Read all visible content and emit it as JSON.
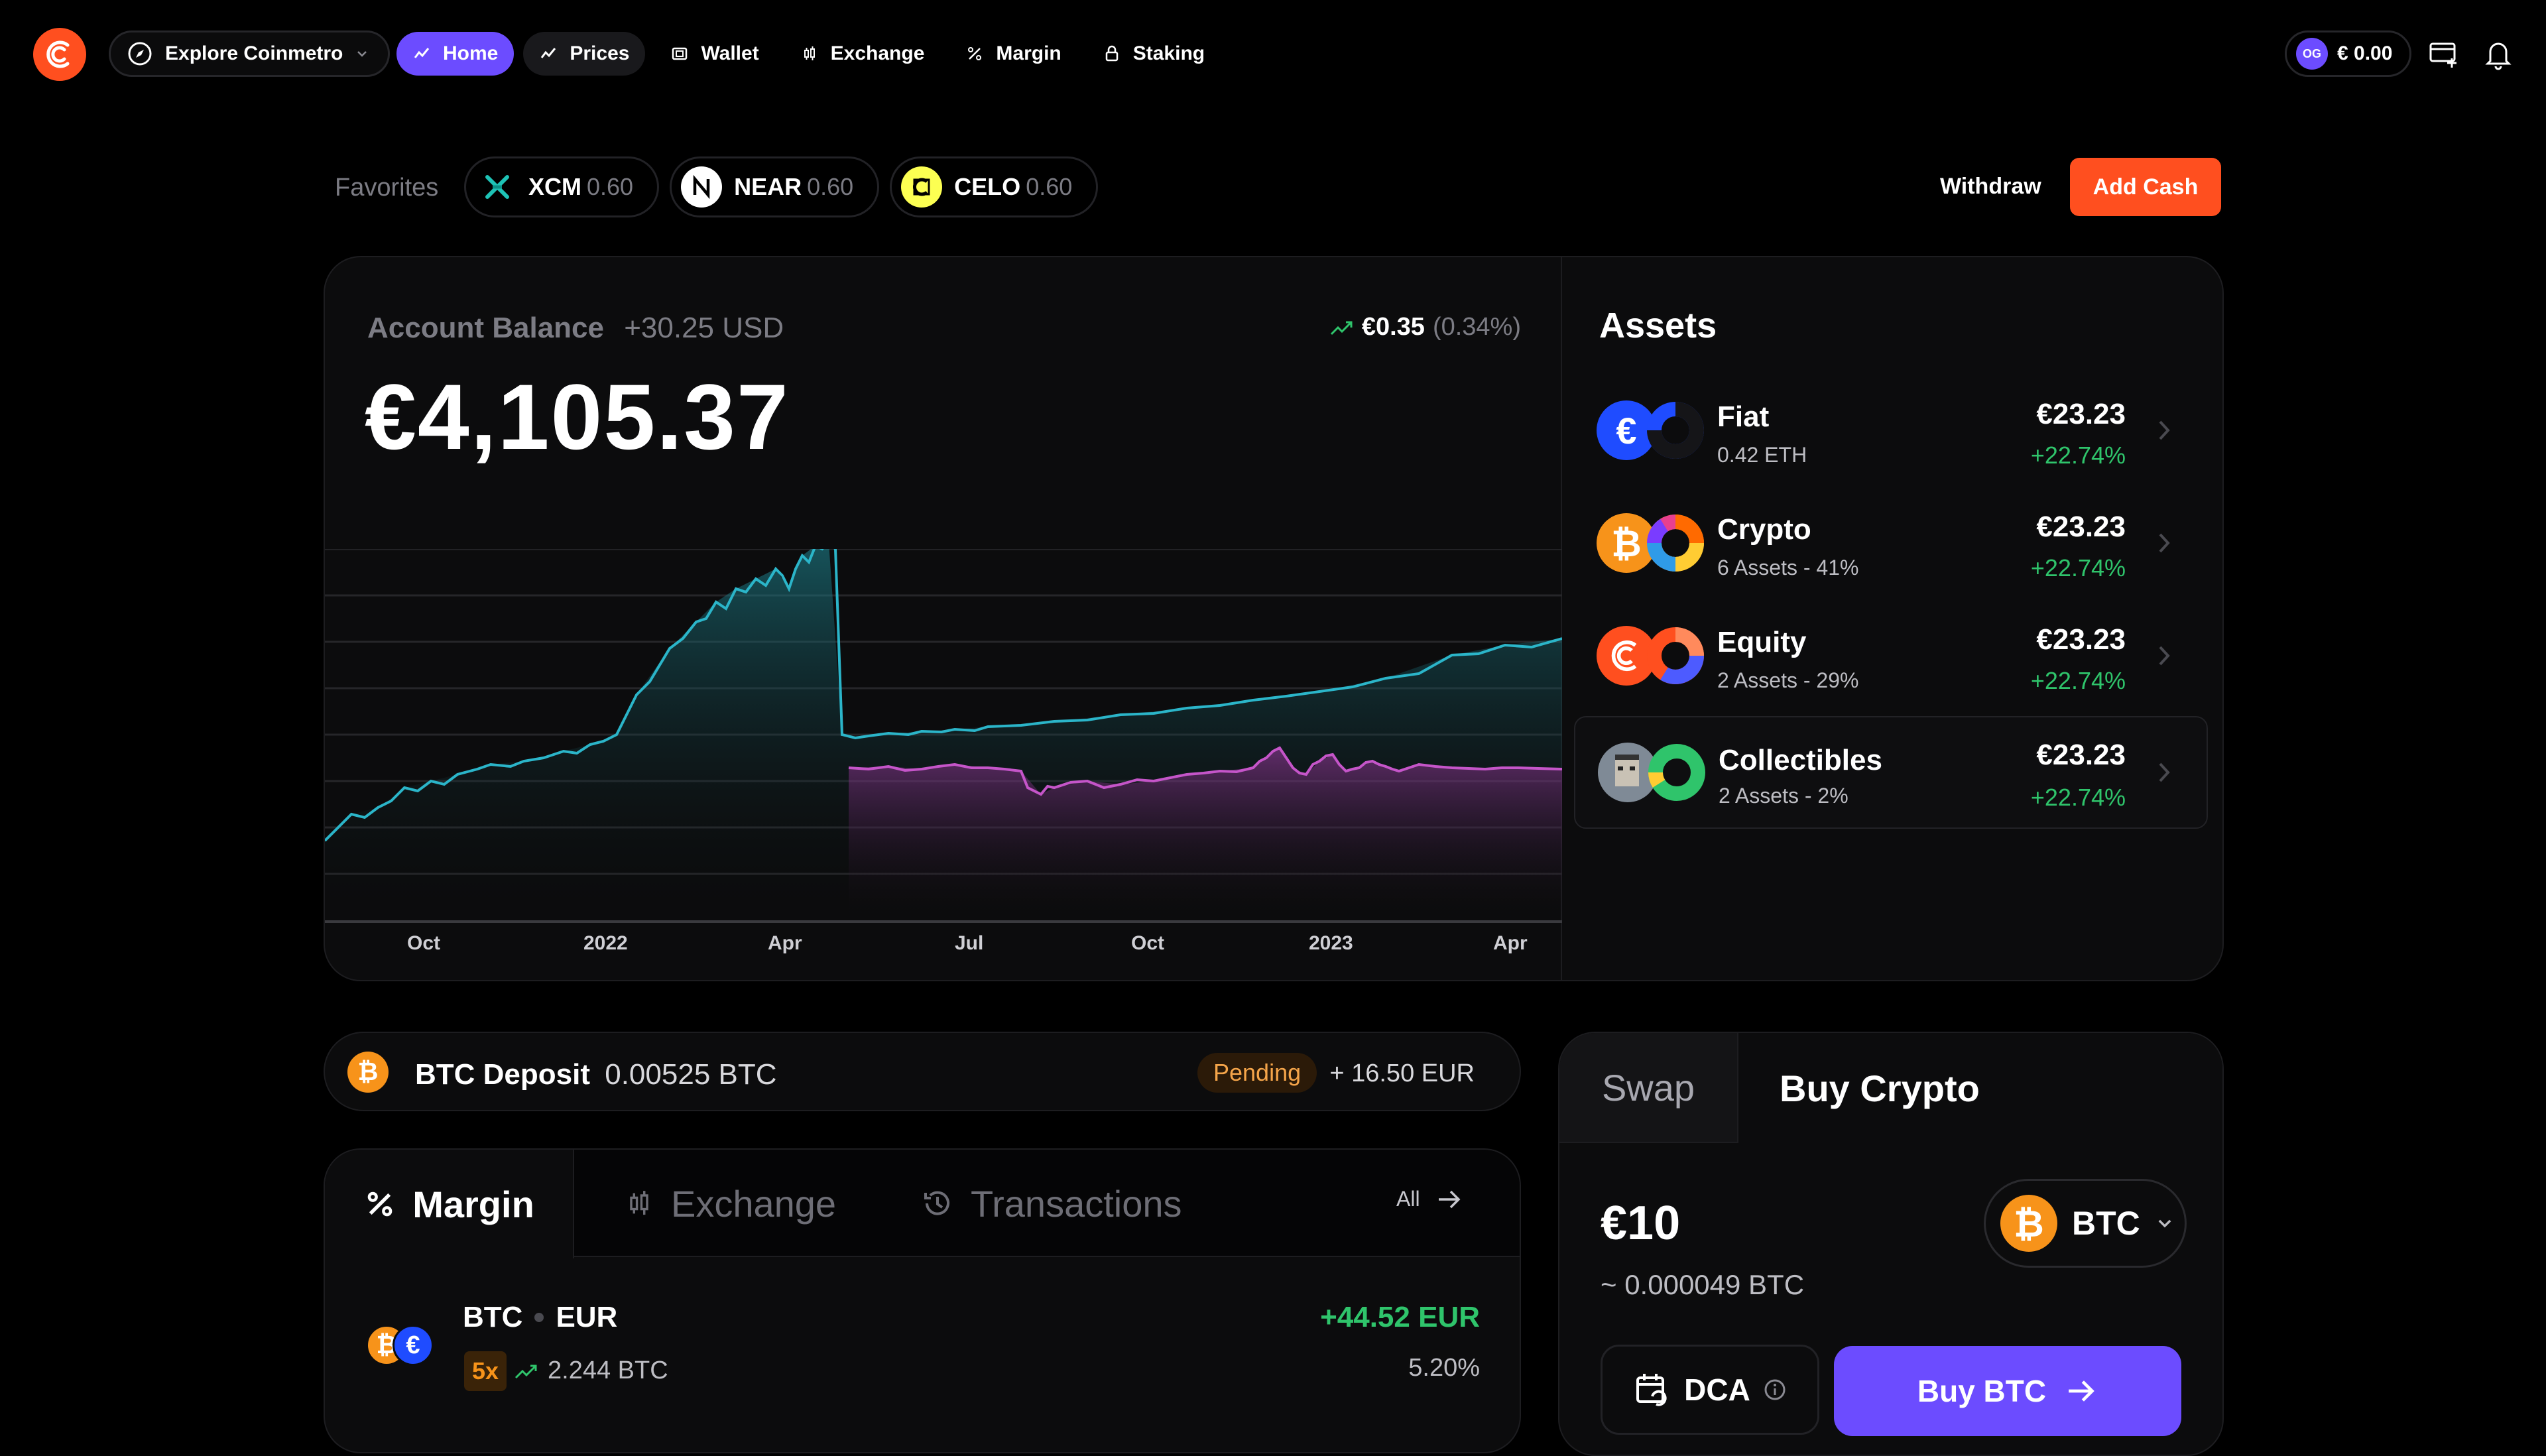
{
  "nav": {
    "explore_label": "Explore Coinmetro",
    "items": [
      {
        "label": "Home"
      },
      {
        "label": "Prices"
      },
      {
        "label": "Wallet"
      },
      {
        "label": "Exchange"
      },
      {
        "label": "Margin"
      },
      {
        "label": "Staking"
      }
    ],
    "wallet_avatar": "OG",
    "wallet_balance": "€ 0.00"
  },
  "favorites": {
    "label": "Favorites",
    "items": [
      {
        "symbol": "XCM",
        "value": "0.60",
        "icon": "xcm-icon",
        "color": "#1ec3b6"
      },
      {
        "symbol": "NEAR",
        "value": "0.60",
        "icon": "near-icon",
        "color": "#ffffff"
      },
      {
        "symbol": "CELO",
        "value": "0.60",
        "icon": "celo-icon",
        "color": "#fcff52"
      }
    ]
  },
  "actions": {
    "withdraw": "Withdraw",
    "add_cash": "Add Cash"
  },
  "balance": {
    "label": "Account Balance",
    "delta_usd": "+30.25 USD",
    "amount": "€4,105.37",
    "change_value": "€0.35",
    "change_pct": "(0.34%)"
  },
  "chart_data": {
    "type": "area",
    "x_ticks": [
      "Oct",
      "2022",
      "Apr",
      "Jul",
      "Oct",
      "2023",
      "Apr"
    ],
    "series": [],
    "colors": {
      "primary": "#2bb5c9",
      "secondary": "#c555c9"
    }
  },
  "assets": {
    "title": "Assets",
    "items": [
      {
        "name": "Fiat",
        "sub": "0.42 ETH",
        "value": "€23.23",
        "change": "+22.74%"
      },
      {
        "name": "Crypto",
        "sub": "6 Assets - 41%",
        "value": "€23.23",
        "change": "+22.74%"
      },
      {
        "name": "Equity",
        "sub": "2 Assets - 29%",
        "value": "€23.23",
        "change": "+22.74%"
      },
      {
        "name": "Collectibles",
        "sub": "2 Assets - 2%",
        "value": "€23.23",
        "change": "+22.74%"
      }
    ]
  },
  "deposit": {
    "title": "BTC Deposit",
    "amount": "0.00525 BTC",
    "status": "Pending",
    "value": "+ 16.50 EUR"
  },
  "positions": {
    "tabs": [
      {
        "label": "Margin"
      },
      {
        "label": "Exchange"
      },
      {
        "label": "Transactions"
      }
    ],
    "all_label": "All",
    "row": {
      "base": "BTC",
      "quote": "EUR",
      "leverage": "5x",
      "size": "2.244 BTC",
      "pnl": "+44.52 EUR",
      "pnl_pct": "5.20%"
    }
  },
  "trade": {
    "tabs": [
      {
        "label": "Swap"
      },
      {
        "label": "Buy Crypto"
      }
    ],
    "amount": "€10",
    "estimate": "~ 0.000049 BTC",
    "asset": "BTC",
    "dca_label": "DCA",
    "buy_label": "Buy BTC"
  },
  "colors": {
    "accent": "#6c4cff",
    "brand": "#ff4f1f",
    "positive": "#2fc46b",
    "btc": "#f7931a"
  }
}
